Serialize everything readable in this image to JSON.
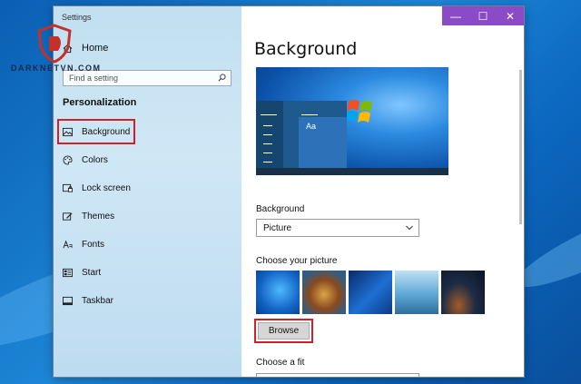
{
  "watermark": {
    "text": "DARKNETVN.COM"
  },
  "window": {
    "title": "Settings",
    "controls": {
      "minimize": "—",
      "maximize": "☐",
      "close": "✕"
    }
  },
  "sidebar": {
    "home_label": "Home",
    "search_placeholder": "Find a setting",
    "section_title": "Personalization",
    "items": [
      {
        "label": "Background",
        "icon": "picture-icon",
        "selected": true
      },
      {
        "label": "Colors",
        "icon": "palette-icon"
      },
      {
        "label": "Lock screen",
        "icon": "lock-screen-icon"
      },
      {
        "label": "Themes",
        "icon": "themes-icon"
      },
      {
        "label": "Fonts",
        "icon": "fonts-icon"
      },
      {
        "label": "Start",
        "icon": "start-icon"
      },
      {
        "label": "Taskbar",
        "icon": "taskbar-icon"
      }
    ]
  },
  "main": {
    "heading": "Background",
    "preview_tile_text": "Aa",
    "background_label": "Background",
    "background_value": "Picture",
    "choose_picture_label": "Choose your picture",
    "browse_label": "Browse",
    "choose_fit_label": "Choose a fit"
  },
  "colors": {
    "accent": "#8c4bc6",
    "highlight": "#d32026"
  }
}
